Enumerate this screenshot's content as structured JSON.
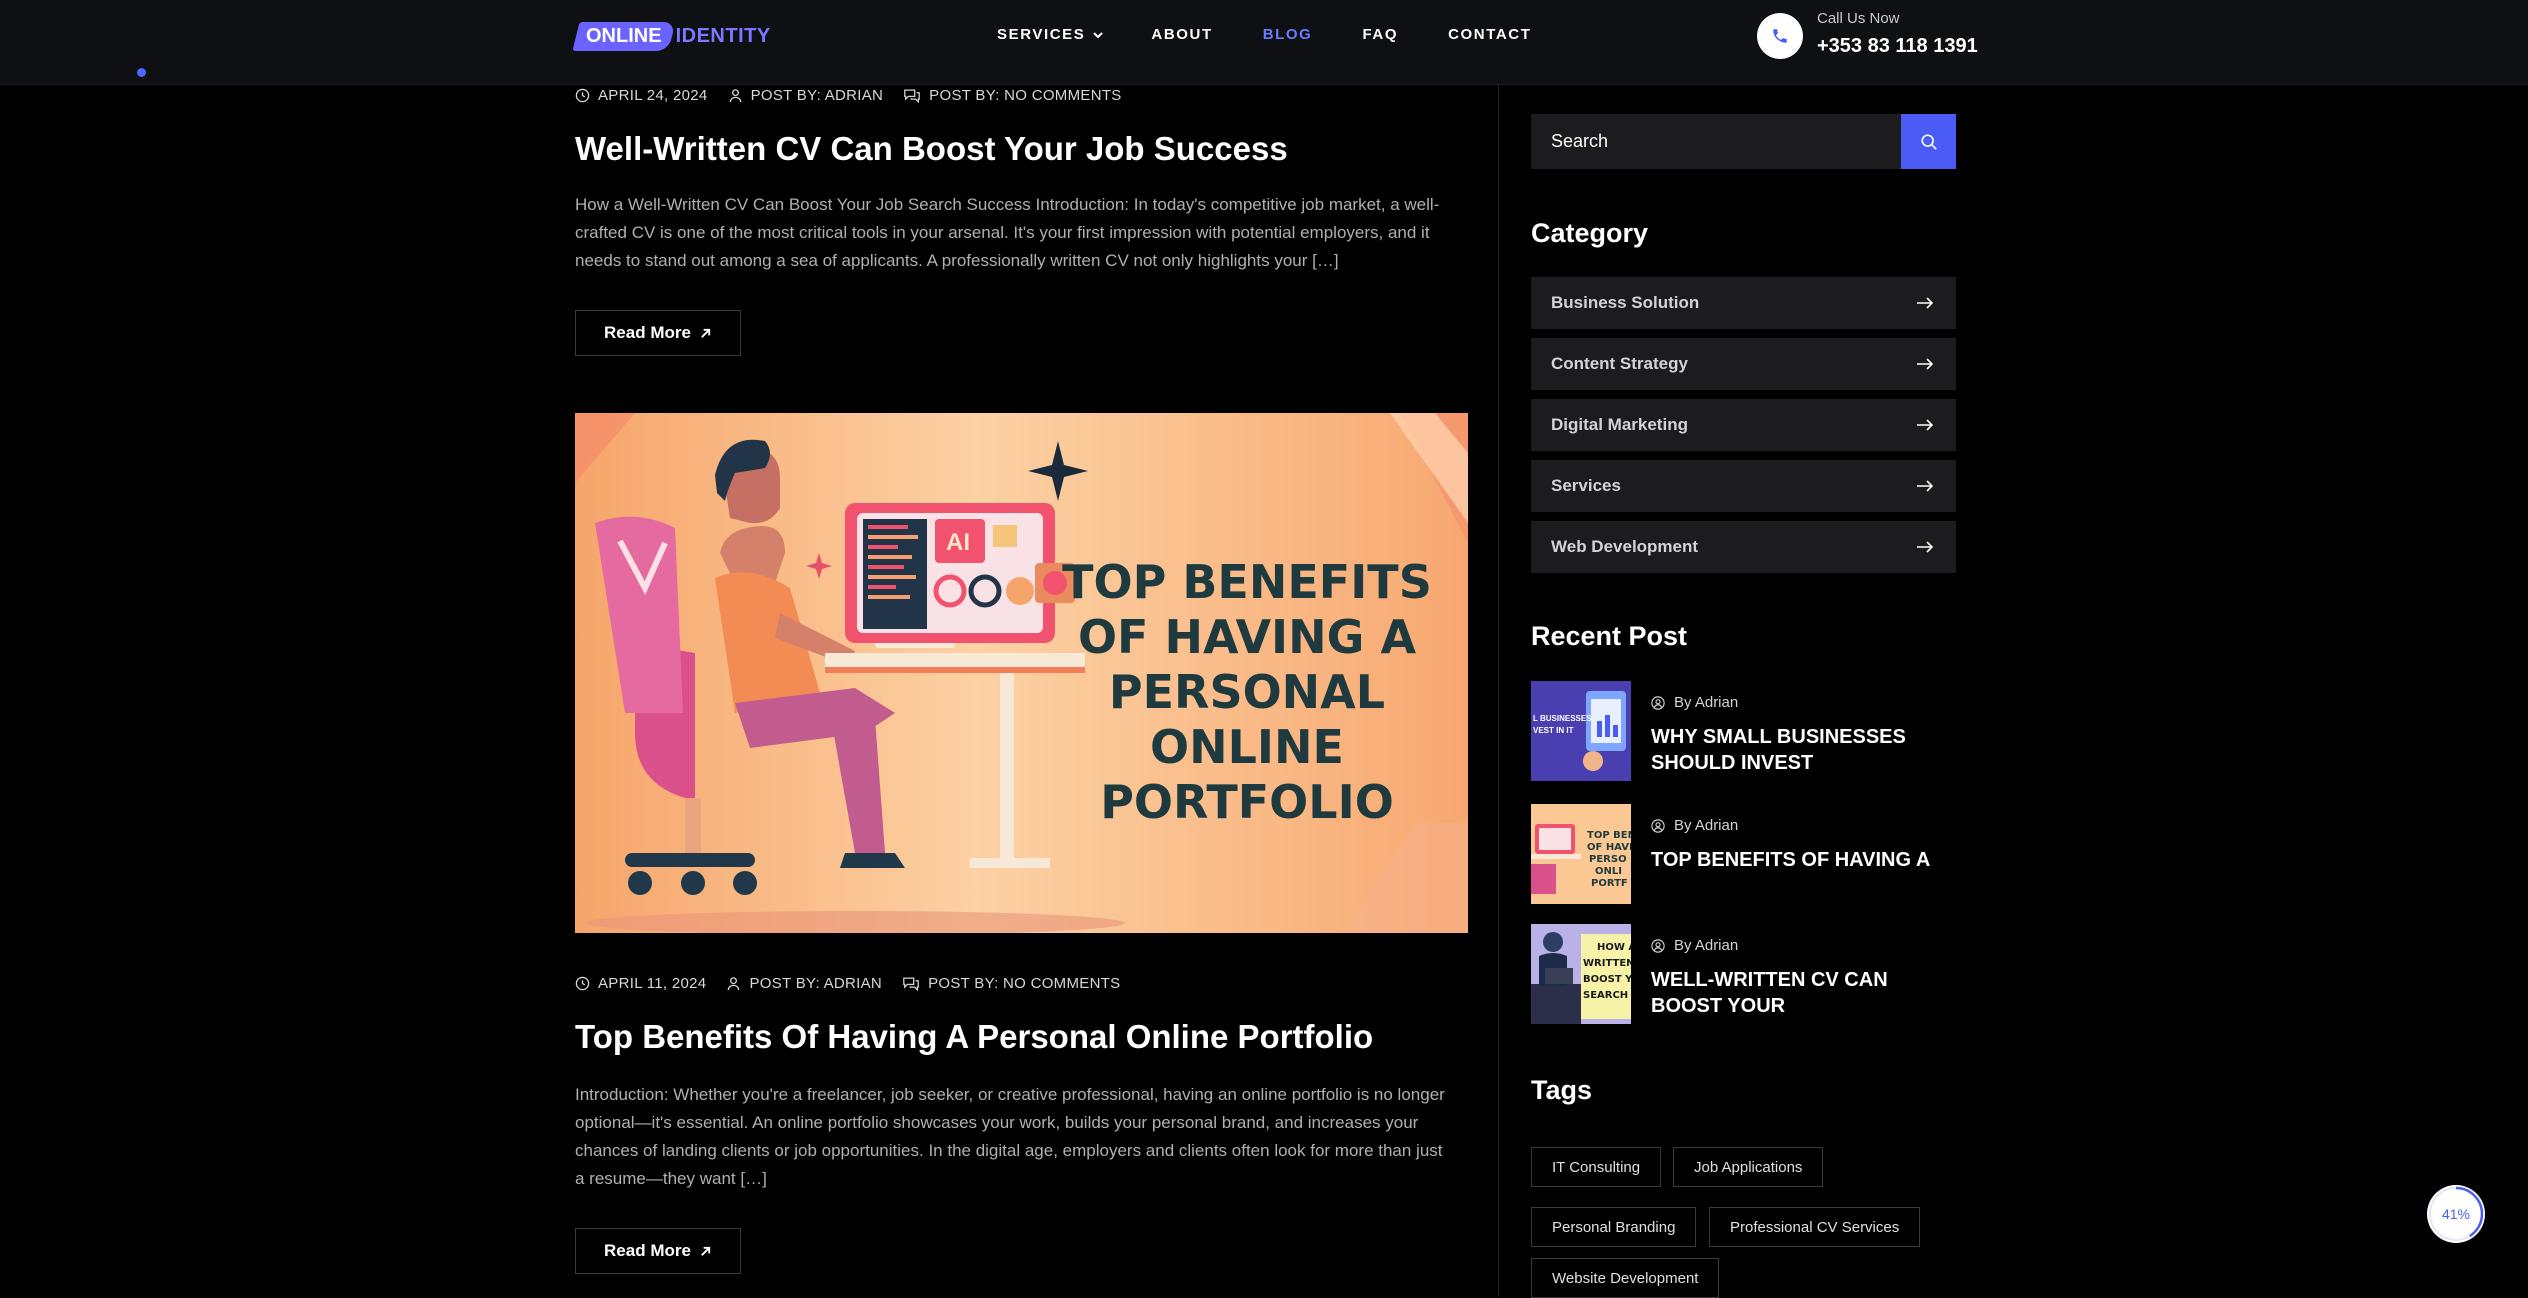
{
  "header": {
    "logo_part1": "ONLINE",
    "logo_part2": "IDENTITY",
    "nav": [
      {
        "label": "SERVICES"
      },
      {
        "label": "ABOUT"
      },
      {
        "label": "BLOG"
      },
      {
        "label": "FAQ"
      },
      {
        "label": "CONTACT"
      }
    ],
    "call_label": "Call Us Now",
    "call_number": "+353 83 118 1391"
  },
  "posts": [
    {
      "date": "APRIL 24, 2024",
      "author": "POST BY: ADRIAN",
      "comments": "POST BY: NO COMMENTS",
      "title": "Well-Written CV Can Boost Your Job Success",
      "excerpt": "How a Well-Written CV Can Boost Your Job Search Success Introduction: In today's competitive job market, a well-crafted CV is one of the most critical tools in your arsenal. It's your first impression with potential employers, and it needs to stand out among a sea of applicants. A professionally written CV not only highlights your […]",
      "read_more": "Read More"
    },
    {
      "image_text": [
        "TOP BENEFITS",
        "OF HAVING A",
        "PERSONAL",
        "ONLINE",
        "PORTFOLIO"
      ],
      "image_badge": "AI",
      "date": "APRIL 11, 2024",
      "author": "POST BY: ADRIAN",
      "comments": "POST BY: NO COMMENTS",
      "title": "Top Benefits Of Having A Personal Online Portfolio",
      "excerpt": "Introduction: Whether you're a freelancer, job seeker, or creative professional, having an online portfolio is no longer optional—it's essential. An online portfolio showcases your work, builds your personal brand, and increases your chances of landing clients or job opportunities. In the digital age, employers and clients often look for more than just a resume—they want […]",
      "read_more": "Read More"
    }
  ],
  "sidebar": {
    "search_placeholder": "Search",
    "category_heading": "Category",
    "categories": [
      {
        "label": "Business Solution"
      },
      {
        "label": "Content Strategy"
      },
      {
        "label": "Digital Marketing"
      },
      {
        "label": "Services"
      },
      {
        "label": "Web Development"
      }
    ],
    "recent_heading": "Recent Post",
    "recent": [
      {
        "by": "By Adrian",
        "title": "WHY SMALL BUSINESSES SHOULD INVEST",
        "thumb_text": [
          "L BUSINESSES",
          "VEST IN IT"
        ]
      },
      {
        "by": "By Adrian",
        "title": "TOP BENEFITS OF HAVING A",
        "thumb_text": [
          "TOP BEN",
          "OF HAVI",
          "PERSO",
          "ONLI",
          "PORTF"
        ]
      },
      {
        "by": "By Adrian",
        "title": "WELL-WRITTEN CV CAN BOOST YOUR",
        "thumb_text": [
          "HOW A",
          "WRITTEN",
          "BOOST YO",
          "SEARCH S"
        ]
      }
    ],
    "tags_heading": "Tags",
    "tags": [
      {
        "label": "IT Consulting"
      },
      {
        "label": "Job Applications"
      },
      {
        "label": "Personal Branding"
      },
      {
        "label": "Professional CV Services"
      },
      {
        "label": "Website Development"
      }
    ]
  },
  "scroll_progress": {
    "value": 0.41,
    "label": "41%"
  },
  "colors": {
    "accent": "#4a5cf5",
    "background": "#000000",
    "header_bg": "#0f1013",
    "panel": "#1c1c1f",
    "hero_text": "#1f3a3f"
  }
}
